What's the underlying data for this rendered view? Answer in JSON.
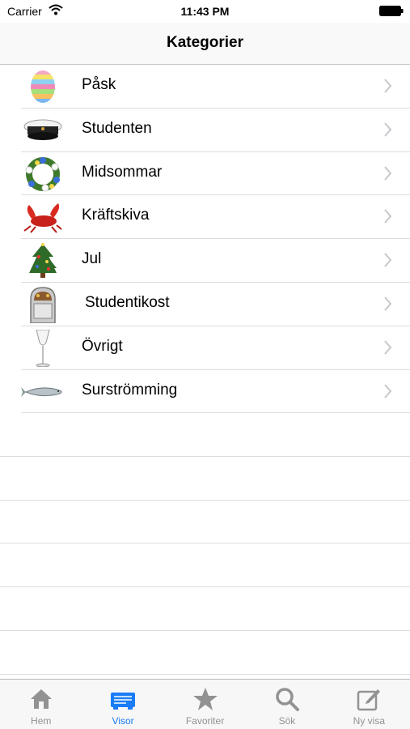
{
  "status": {
    "carrier": "Carrier",
    "time": "11:43 PM"
  },
  "nav": {
    "title": "Kategorier"
  },
  "categories": [
    {
      "label": "Påsk",
      "icon": "easter-egg-icon"
    },
    {
      "label": "Studenten",
      "icon": "student-cap-icon"
    },
    {
      "label": "Midsommar",
      "icon": "flower-wreath-icon"
    },
    {
      "label": "Kräftskiva",
      "icon": "crayfish-icon"
    },
    {
      "label": "Jul",
      "icon": "christmas-tree-icon"
    },
    {
      "label": "Studentikost",
      "icon": "jukebox-icon"
    },
    {
      "label": "Övrigt",
      "icon": "champagne-glass-icon"
    },
    {
      "label": "Surströmming",
      "icon": "herring-fish-icon"
    }
  ],
  "tabs": [
    {
      "label": "Hem",
      "icon": "house-icon",
      "active": false
    },
    {
      "label": "Visor",
      "icon": "songbook-icon",
      "active": true
    },
    {
      "label": "Favoriter",
      "icon": "star-icon",
      "active": false
    },
    {
      "label": "Sök",
      "icon": "magnifier-icon",
      "active": false
    },
    {
      "label": "Ny visa",
      "icon": "compose-icon",
      "active": false
    }
  ],
  "colors": {
    "accent": "#1a7cf6",
    "inactive": "#929292"
  }
}
